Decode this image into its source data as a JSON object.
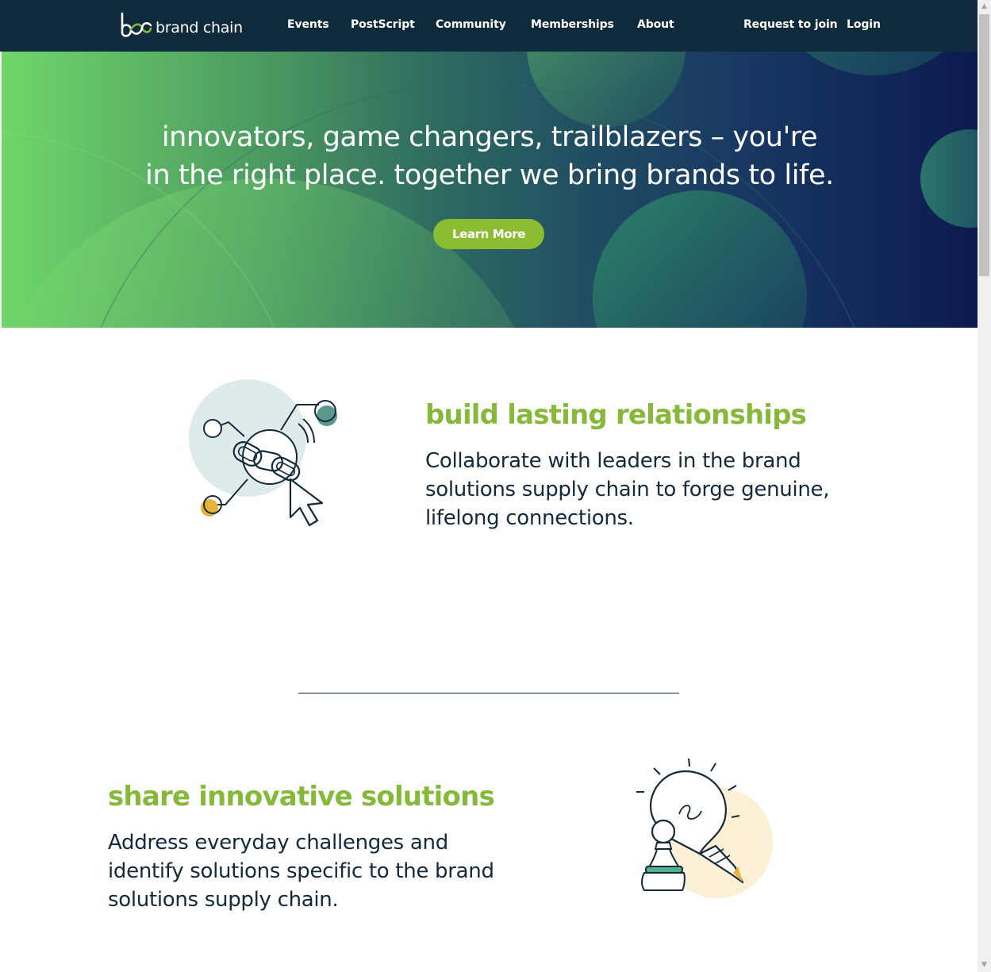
{
  "nav": {
    "logo_text": "brand chain",
    "links": [
      "Events",
      "PostScript",
      "Community",
      "Memberships",
      "About"
    ],
    "request_to_join": "Request to join",
    "login": "Login"
  },
  "hero": {
    "headline_line1": "innovators, game changers, trailblazers – you're",
    "headline_line2": "in the right place. together we bring brands to life.",
    "cta": "Learn More"
  },
  "features": [
    {
      "title": "build lasting relationships",
      "body": "Collaborate with leaders in the brand solutions supply chain to forge genuine, lifelong connections.",
      "icon": "chain-link-cursor-icon"
    },
    {
      "title": "share innovative solutions",
      "body": "Address everyday challenges and identify solutions specific to the brand solutions supply chain.",
      "icon": "lightbulb-chess-pawn-icon"
    }
  ],
  "colors": {
    "nav_bg": "#0f2a3a",
    "accent_green": "#86b83a",
    "button_green": "#8cbc32",
    "text_dark": "#14293a"
  }
}
